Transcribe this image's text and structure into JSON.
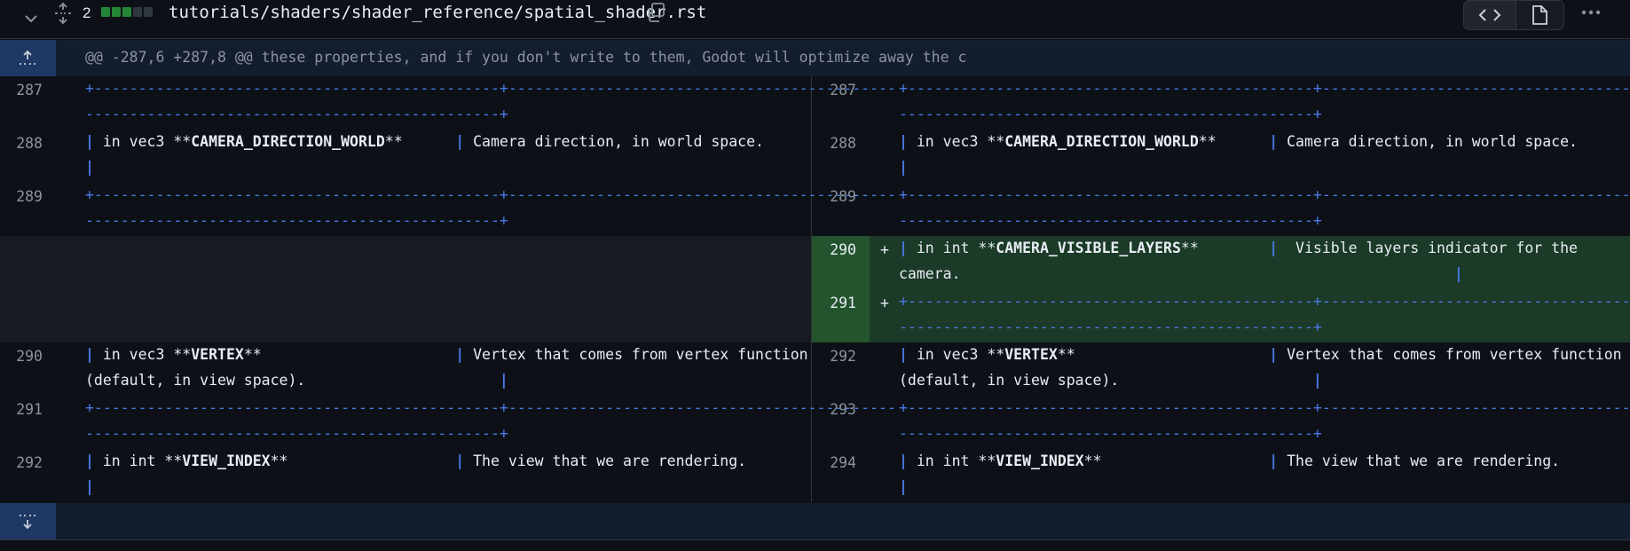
{
  "file_header": {
    "changes_count": "2",
    "diffstat": [
      "#238636",
      "#238636",
      "#238636",
      "#30363d",
      "#30363d"
    ],
    "path": "tutorials/shaders/shader_reference/spatial_shader.rst",
    "icons": [
      "chevron-down-icon",
      "unfold-icon",
      "copy-icon",
      "code-icon",
      "file-icon",
      "kebab-icon"
    ]
  },
  "hunk": {
    "header": "@@ -287,6 +287,8 @@ these properties, and if you don't write to them, Godot will optimize away the c"
  },
  "colors": {
    "dash": "#4a7ae8",
    "added_bg": "#1b3a27",
    "added_gutter": "#24542e",
    "hunk_gutter": "#1f3964"
  },
  "left": {
    "rows": [
      {
        "num": "287",
        "l1": "+----------------------------------------------+--------------------------------------------",
        "l2": "-----------------------------------------------+"
      },
      {
        "num": "288",
        "l1_pre": "| in vec3 **",
        "l1_bold": "CAMERA_DIRECTION_WORLD",
        "l1_post": "**      ",
        "l1_pipe": "|",
        "l1_desc": " Camera direction, in world space.",
        "l2": "|"
      },
      {
        "num": "289",
        "l1": "+----------------------------------------------+--------------------------------------------",
        "l2": "-----------------------------------------------+"
      },
      {
        "num": "290",
        "l1_pre": "| in vec3 **",
        "l1_bold": "VERTEX",
        "l1_post": "**                      ",
        "l1_pipe": "|",
        "l1_desc": " Vertex that comes from vertex function",
        "l2": "(default, in view space).",
        "l2_pipe": "|"
      },
      {
        "num": "291",
        "l1": "+----------------------------------------------+--------------------------------------------",
        "l2": "-----------------------------------------------+"
      },
      {
        "num": "292",
        "l1_pre": "| in int **",
        "l1_bold": "VIEW_INDEX",
        "l1_post": "**                   ",
        "l1_pipe": "|",
        "l1_desc": " The view that we are rendering.",
        "l2": "|"
      }
    ]
  },
  "right": {
    "rows": [
      {
        "num": "287",
        "l1": "+----------------------------------------------+--------------------------------------------",
        "l2": "-----------------------------------------------+"
      },
      {
        "num": "288",
        "l1_pre": "| in vec3 **",
        "l1_bold": "CAMERA_DIRECTION_WORLD",
        "l1_post": "**      ",
        "l1_pipe": "|",
        "l1_desc": " Camera direction, in world space.",
        "l2": "|"
      },
      {
        "num": "289",
        "l1": "+----------------------------------------------+--------------------------------------------",
        "l2": "-----------------------------------------------+"
      },
      {
        "num": "290",
        "added": true,
        "marker": "+",
        "l1_pre": "| in int **",
        "l1_bold": "CAMERA_VISIBLE_LAYERS",
        "l1_post": "**        ",
        "l1_pipe": "|",
        "l1_desc": "  Visible layers indicator for the",
        "l2": "camera.",
        "l2_pipe": "|"
      },
      {
        "num": "291",
        "added": true,
        "marker": "+",
        "l1": "+----------------------------------------------+--------------------------------------------",
        "l2": "-----------------------------------------------+"
      },
      {
        "num": "292",
        "l1_pre": "| in vec3 **",
        "l1_bold": "VERTEX",
        "l1_post": "**                      ",
        "l1_pipe": "|",
        "l1_desc": " Vertex that comes from vertex function",
        "l2": "(default, in view space).",
        "l2_pipe": "|"
      },
      {
        "num": "293",
        "l1": "+----------------------------------------------+--------------------------------------------",
        "l2": "-----------------------------------------------+"
      },
      {
        "num": "294",
        "l1_pre": "| in int **",
        "l1_bold": "VIEW_INDEX",
        "l1_post": "**                   ",
        "l1_pipe": "|",
        "l1_desc": " The view that we are rendering.",
        "l2": "|"
      }
    ]
  }
}
